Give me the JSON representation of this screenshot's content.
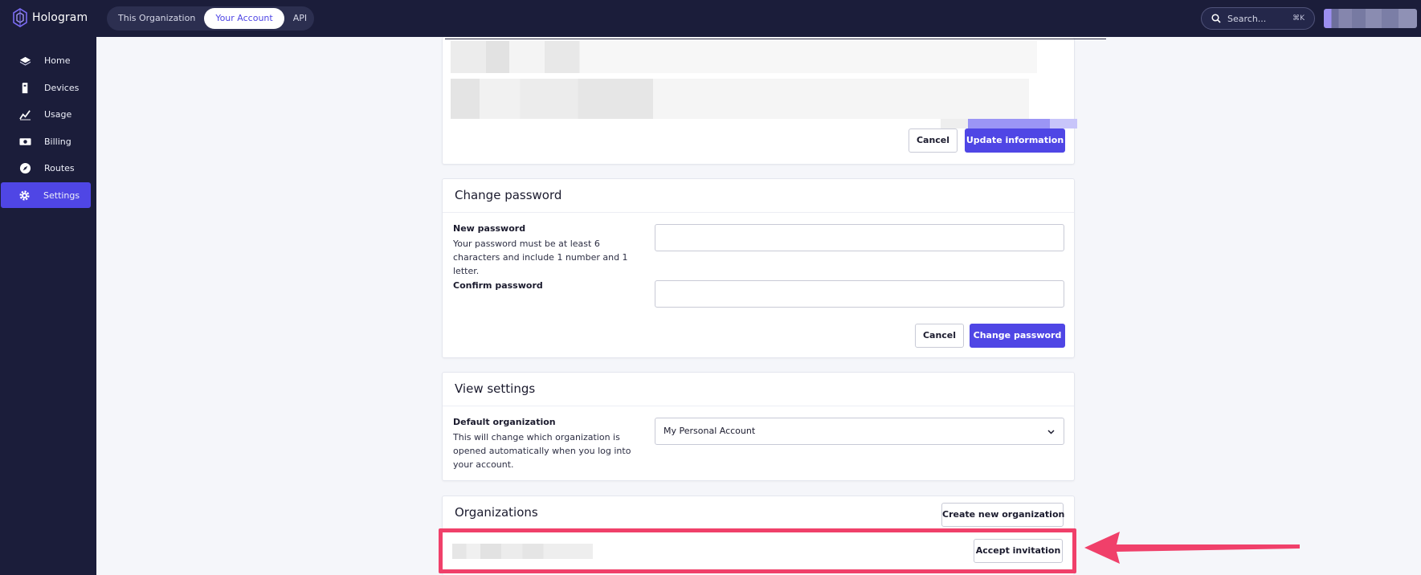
{
  "brand": {
    "name": "Hologram",
    "accent": "#4f46e5",
    "highlight": "#f0406a"
  },
  "top_tabs": [
    {
      "label": "This Organization",
      "active": false
    },
    {
      "label": "Your Account",
      "active": true
    },
    {
      "label": "API",
      "active": false
    }
  ],
  "search": {
    "placeholder": "Search...",
    "shortcut": "⌘K"
  },
  "sidebar": {
    "items": [
      {
        "label": "Home",
        "icon": "home-icon",
        "active": false
      },
      {
        "label": "Devices",
        "icon": "device-icon",
        "active": false
      },
      {
        "label": "Usage",
        "icon": "chart-line-icon",
        "active": false
      },
      {
        "label": "Billing",
        "icon": "billing-icon",
        "active": false
      },
      {
        "label": "Routes",
        "icon": "compass-icon",
        "active": false
      },
      {
        "label": "Settings",
        "icon": "gear-icon",
        "active": true
      }
    ]
  },
  "account_info": {
    "cancel_label": "Cancel",
    "submit_label": "Update information"
  },
  "change_password": {
    "title": "Change password",
    "new_label": "New password",
    "new_help": "Your password must be at least 6 characters and include 1 number and 1 letter.",
    "confirm_label": "Confirm password",
    "cancel_label": "Cancel",
    "submit_label": "Change password"
  },
  "view_settings": {
    "title": "View settings",
    "default_org_label": "Default organization",
    "default_org_help": "This will change which organization is opened automatically when you log into your account.",
    "default_org_value": "My Personal Account"
  },
  "organizations": {
    "title": "Organizations",
    "create_label": "Create new organization",
    "accept_label": "Accept invitation"
  }
}
